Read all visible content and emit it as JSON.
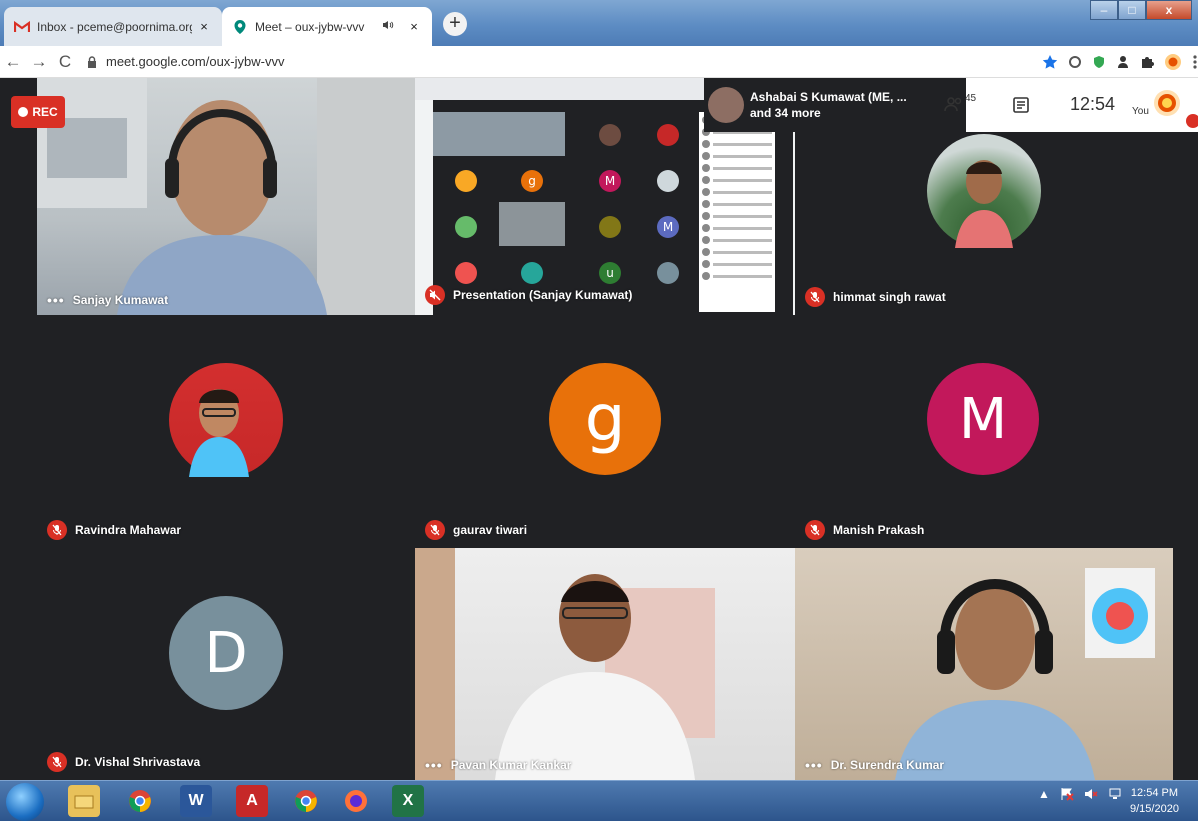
{
  "browser": {
    "tabs": [
      {
        "title": "Inbox - pceme@poornima.org - ",
        "icon": "gmail-icon",
        "active": false
      },
      {
        "title": "Meet – oux-jybw-vvv",
        "icon": "meet-icon",
        "active": true
      }
    ],
    "close_glyph": "×",
    "new_tab_glyph": "+",
    "window_controls": {
      "minimize": "–",
      "maximize": "□",
      "close": "x"
    },
    "url": "meet.google.com/oux-jybw-vvv",
    "nav": {
      "back": "←",
      "forward": "→",
      "reload": "C"
    }
  },
  "meet": {
    "rec_label": "REC",
    "top_bar": {
      "presenter_line1": "Ashabai S Kumawat (ME, ...",
      "presenter_line2": "and 34 more",
      "participant_count": "45",
      "time": "12:54",
      "you_label": "You"
    },
    "tiles": [
      {
        "id": "sanjay",
        "name": "Sanjay Kumawat",
        "indicator": "dots",
        "kind": "video"
      },
      {
        "id": "presentation",
        "name": "Presentation (Sanjay Kumawat)",
        "indicator": "muted-speaker",
        "kind": "screen"
      },
      {
        "id": "himmat",
        "name": "himmat singh rawat",
        "indicator": "mic-off",
        "kind": "photo"
      },
      {
        "id": "ravindra",
        "name": "Ravindra Mahawar",
        "indicator": "mic-off",
        "kind": "photo"
      },
      {
        "id": "gaurav",
        "name": "gaurav tiwari",
        "indicator": "mic-off",
        "kind": "letter",
        "letter": "g"
      },
      {
        "id": "manish",
        "name": "Manish Prakash",
        "indicator": "mic-off",
        "kind": "letter",
        "letter": "M"
      },
      {
        "id": "vishal",
        "name": "Dr. Vishal Shrivastava",
        "indicator": "mic-off",
        "kind": "letter",
        "letter": "D"
      },
      {
        "id": "pavan",
        "name": "Pavan Kumar Kankar",
        "indicator": "dots",
        "kind": "video"
      },
      {
        "id": "surendra",
        "name": "Dr. Surendra Kumar",
        "indicator": "dots",
        "kind": "video"
      }
    ],
    "presentation_grid_letters": [
      "g",
      "M",
      "M",
      "u"
    ]
  },
  "colors": {
    "gaurav": "#e8710a",
    "manish": "#c2185b",
    "vishal": "#78909c",
    "mic_off": "#d93025",
    "stage_bg": "#202124"
  },
  "taskbar": {
    "clock_time": "12:54 PM",
    "clock_date": "9/15/2020",
    "apps": [
      "explorer-icon",
      "chrome-icon",
      "word-icon",
      "acrobat-icon",
      "chrome-icon",
      "firefox-icon",
      "excel-icon"
    ]
  }
}
